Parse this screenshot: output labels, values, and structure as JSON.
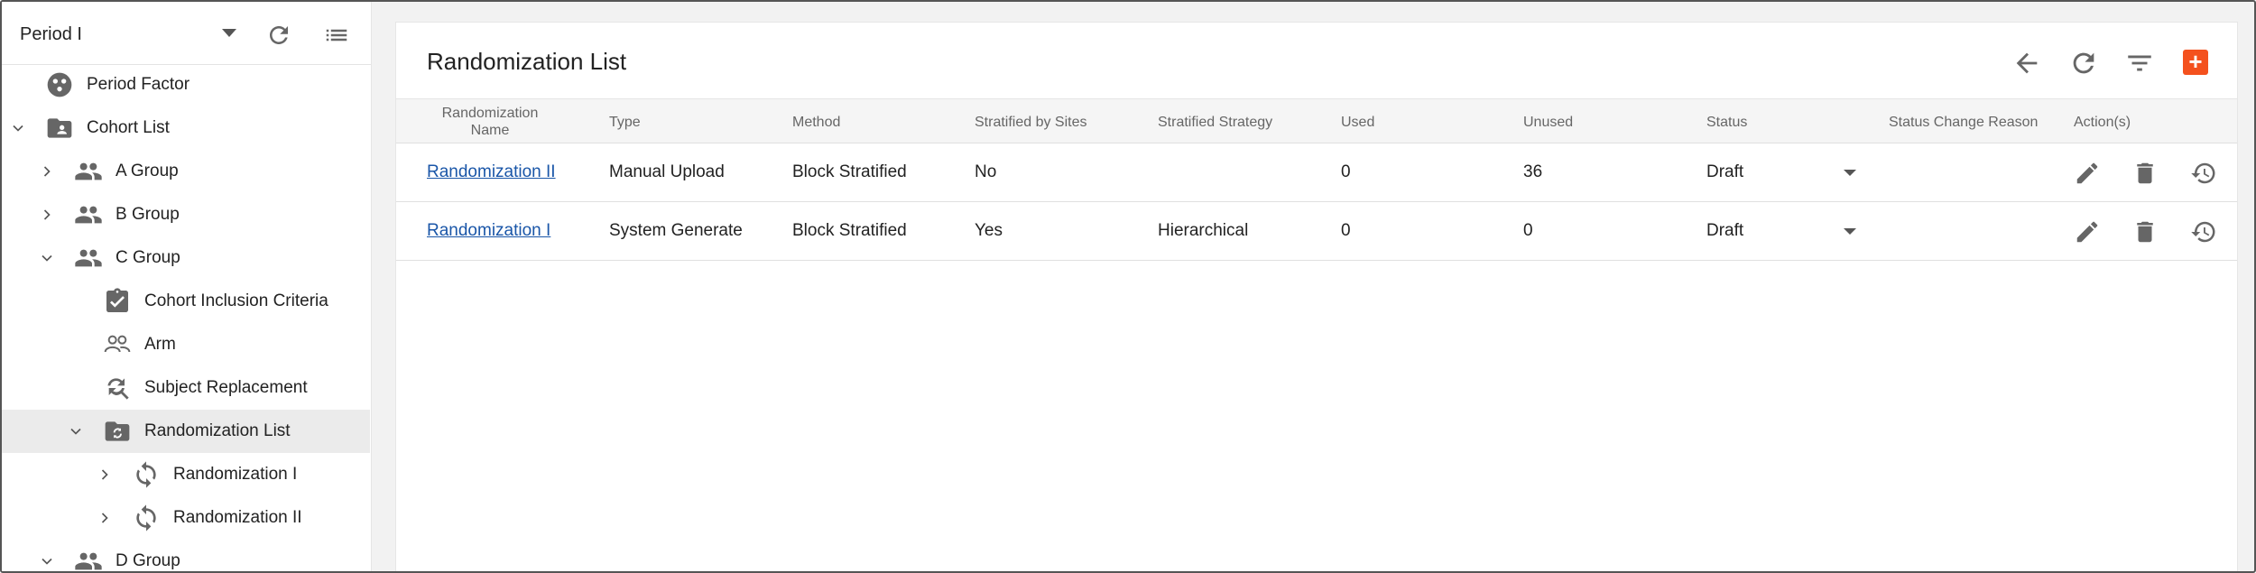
{
  "sidebar": {
    "period_select": {
      "value": "Period I",
      "icon": "chevron-down-icon"
    },
    "header_icons": [
      "refresh-icon",
      "list-icon"
    ],
    "tree": [
      {
        "label": "Period Factor",
        "icon": "factor-icon",
        "chevron": "none"
      },
      {
        "label": "Cohort List",
        "icon": "contact-folder-icon",
        "chevron": "expanded"
      },
      {
        "label": "A Group",
        "icon": "group-icon",
        "chevron": "collapsed"
      },
      {
        "label": "B Group",
        "icon": "group-icon",
        "chevron": "collapsed"
      },
      {
        "label": "C Group",
        "icon": "group-icon",
        "chevron": "expanded"
      },
      {
        "label": "Cohort Inclusion Criteria",
        "icon": "clipboard-check-icon",
        "chevron": "none"
      },
      {
        "label": "Arm",
        "icon": "people-outline-icon",
        "chevron": "none"
      },
      {
        "label": "Subject Replacement",
        "icon": "find-replace-icon",
        "chevron": "none"
      },
      {
        "label": "Randomization List",
        "icon": "sync-folder-icon",
        "chevron": "expanded",
        "selected": true
      },
      {
        "label": "Randomization I",
        "icon": "sync-icon",
        "chevron": "collapsed"
      },
      {
        "label": "Randomization II",
        "icon": "sync-icon",
        "chevron": "collapsed"
      },
      {
        "label": "D Group",
        "icon": "group-icon",
        "chevron": "expanded"
      }
    ]
  },
  "main": {
    "title": "Randomization List",
    "toolbar_icons": [
      "back-arrow-icon",
      "refresh-icon",
      "filter-icon",
      "add-icon"
    ],
    "add_label": "+",
    "accent_color": "#f4511e",
    "columns": [
      "Randomization Name",
      "Type",
      "Method",
      "Stratified by Sites",
      "Stratified Strategy",
      "Used",
      "Unused",
      "Status",
      "Status Change Reason",
      "Action(s)"
    ],
    "rows": [
      {
        "name": "Randomization II",
        "type": "Manual Upload",
        "method": "Block Stratified",
        "stratified_by_sites": "No",
        "stratified_strategy": "",
        "used": "0",
        "unused": "36",
        "status": "Draft",
        "status_change_reason": ""
      },
      {
        "name": "Randomization I",
        "type": "System Generate",
        "method": "Block Stratified",
        "stratified_by_sites": "Yes",
        "stratified_strategy": "Hierarchical",
        "used": "0",
        "unused": "0",
        "status": "Draft",
        "status_change_reason": ""
      }
    ],
    "row_action_icons": [
      "edit-icon",
      "delete-icon",
      "history-icon"
    ]
  }
}
